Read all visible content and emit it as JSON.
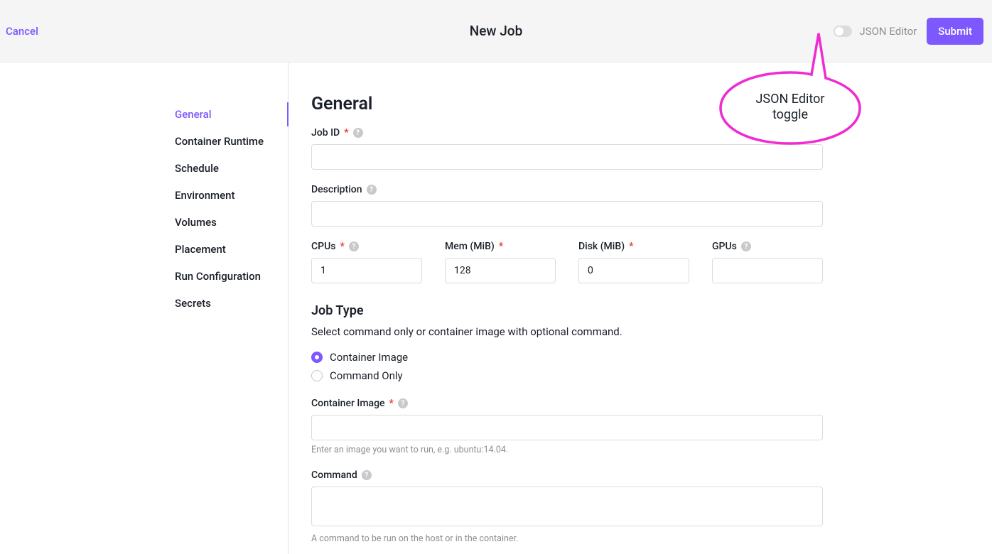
{
  "header": {
    "cancel": "Cancel",
    "title": "New Job",
    "toggle_label": "JSON Editor",
    "submit": "Submit"
  },
  "annotation": {
    "line1": "JSON Editor",
    "line2": "toggle"
  },
  "sidebar": {
    "items": [
      "General",
      "Container Runtime",
      "Schedule",
      "Environment",
      "Volumes",
      "Placement",
      "Run Configuration",
      "Secrets"
    ]
  },
  "form": {
    "section_title": "General",
    "job_id_label": "Job ID",
    "job_id_value": "",
    "description_label": "Description",
    "description_value": "",
    "cpus_label": "CPUs",
    "cpus_value": "1",
    "mem_label": "Mem (MiB)",
    "mem_value": "128",
    "disk_label": "Disk (MiB)",
    "disk_value": "0",
    "gpus_label": "GPUs",
    "gpus_value": "",
    "jobtype_title": "Job Type",
    "jobtype_desc": "Select command only or container image with optional command.",
    "radio_container": "Container Image",
    "radio_command": "Command Only",
    "container_image_label": "Container Image",
    "container_image_value": "",
    "container_image_hint": "Enter an image you want to run, e.g. ubuntu:14.04.",
    "command_label": "Command",
    "command_value": "",
    "command_hint": "A command to be run on the host or in the container."
  }
}
